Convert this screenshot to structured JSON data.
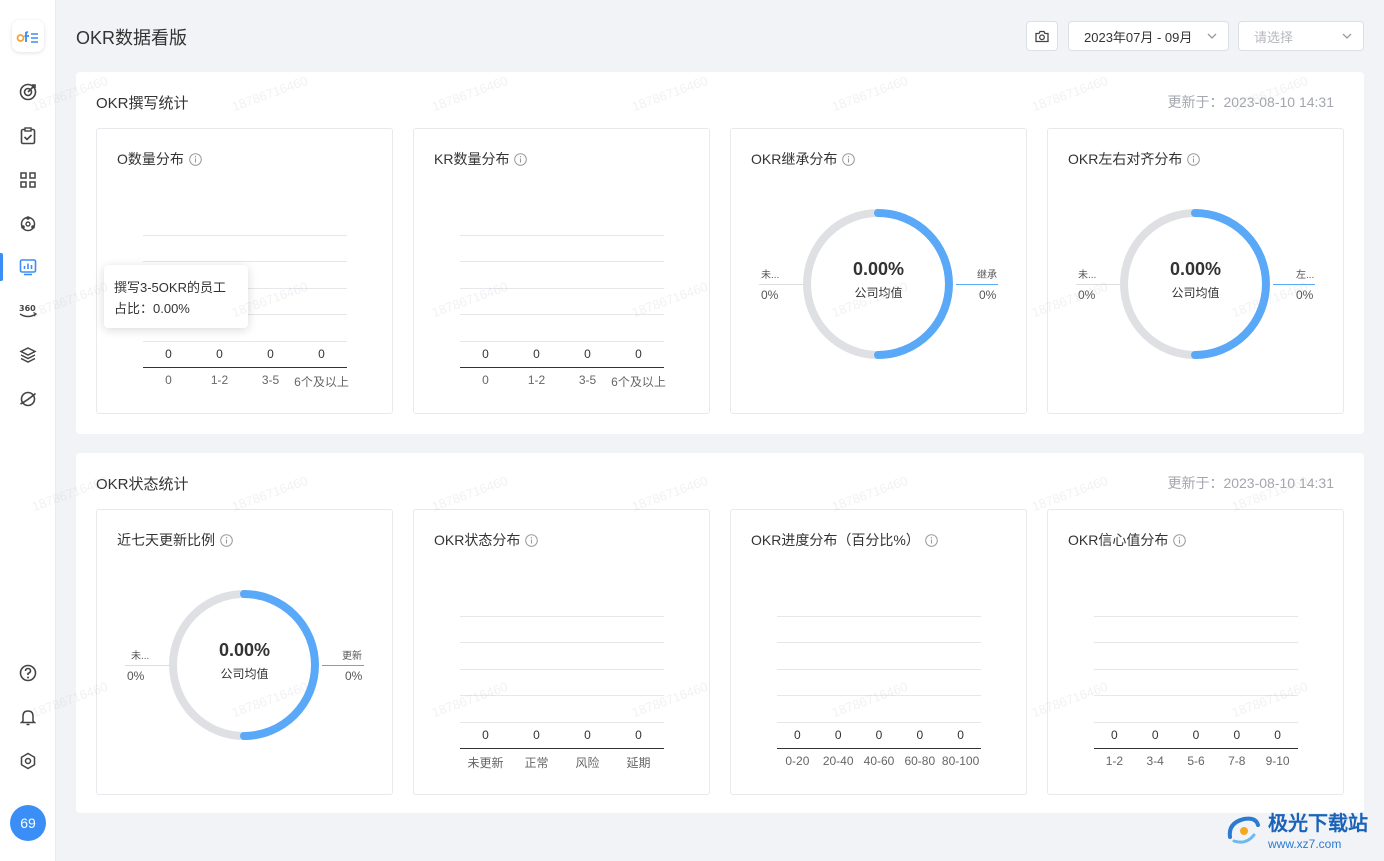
{
  "header": {
    "title": "OKR数据看版",
    "date_range": "2023年07月 - 09月",
    "select_placeholder": "请选择"
  },
  "user": {
    "avatar_text": "69"
  },
  "sidebar": {
    "items": [
      {
        "icon": "target-icon"
      },
      {
        "icon": "clipboard-check-icon"
      },
      {
        "icon": "grid-icon"
      },
      {
        "icon": "network-icon"
      },
      {
        "icon": "dashboard-chart-icon",
        "active": true
      },
      {
        "icon": "360-icon"
      },
      {
        "icon": "layers-icon"
      },
      {
        "icon": "planet-icon"
      }
    ],
    "bottom_items": [
      {
        "icon": "help-icon"
      },
      {
        "icon": "bell-icon"
      },
      {
        "icon": "gear-icon"
      }
    ]
  },
  "colors": {
    "accent": "#3a8ef6",
    "donut_fill": "#5aa8f8",
    "donut_track": "#dfe0e4"
  },
  "sections": {
    "writing": {
      "title": "OKR撰写统计",
      "updated": "更新于：2023-08-10 14:31",
      "cards": {
        "o_dist": {
          "title": "O数量分布"
        },
        "kr_dist": {
          "title": "KR数量分布"
        },
        "inherit": {
          "title": "OKR继承分布",
          "pct": "0.00%",
          "sub": "公司均值",
          "left_label": "未...",
          "left_value": "0%",
          "right_label": "继承",
          "right_value": "0%"
        },
        "align": {
          "title": "OKR左右对齐分布",
          "pct": "0.00%",
          "sub": "公司均值",
          "left_label": "未...",
          "left_value": "0%",
          "right_label": "左...",
          "right_value": "0%"
        }
      }
    },
    "status": {
      "title": "OKR状态统计",
      "updated": "更新于：2023-08-10 14:31",
      "cards": {
        "week_update": {
          "title": "近七天更新比例",
          "pct": "0.00%",
          "sub": "公司均值",
          "left_label": "未...",
          "left_value": "0%",
          "right_label": "更新",
          "right_value": "0%"
        },
        "state_dist": {
          "title": "OKR状态分布"
        },
        "progress_dist": {
          "title": "OKR进度分布（百分比%）"
        },
        "confidence_dist": {
          "title": "OKR信心值分布"
        }
      }
    }
  },
  "tooltip": {
    "line1": "撰写3-5OKR的员工",
    "line2": "占比：0.00%"
  },
  "watermark_text": "18786716460",
  "corner_logo": {
    "line1": "极光下载站",
    "line2": "www.xz7.com"
  },
  "chart_data": [
    {
      "type": "bar",
      "title": "O数量分布",
      "categories": [
        "0",
        "1-2",
        "3-5",
        "6个及以上"
      ],
      "values": [
        0,
        0,
        0,
        0
      ]
    },
    {
      "type": "bar",
      "title": "KR数量分布",
      "categories": [
        "0",
        "1-2",
        "3-5",
        "6个及以上"
      ],
      "values": [
        0,
        0,
        0,
        0
      ]
    },
    {
      "type": "pie",
      "title": "OKR继承分布",
      "categories": [
        "未...",
        "继承"
      ],
      "values": [
        0,
        0
      ]
    },
    {
      "type": "pie",
      "title": "OKR左右对齐分布",
      "categories": [
        "未...",
        "左..."
      ],
      "values": [
        0,
        0
      ]
    },
    {
      "type": "pie",
      "title": "近七天更新比例",
      "categories": [
        "未...",
        "更新"
      ],
      "values": [
        0,
        0
      ]
    },
    {
      "type": "bar",
      "title": "OKR状态分布",
      "categories": [
        "未更新",
        "正常",
        "风险",
        "延期"
      ],
      "values": [
        0,
        0,
        0,
        0
      ]
    },
    {
      "type": "bar",
      "title": "OKR进度分布（百分比%）",
      "categories": [
        "0-20",
        "20-40",
        "40-60",
        "60-80",
        "80-100"
      ],
      "values": [
        0,
        0,
        0,
        0,
        0
      ]
    },
    {
      "type": "bar",
      "title": "OKR信心值分布",
      "categories": [
        "1-2",
        "3-4",
        "5-6",
        "7-8",
        "9-10"
      ],
      "values": [
        0,
        0,
        0,
        0,
        0
      ]
    }
  ]
}
